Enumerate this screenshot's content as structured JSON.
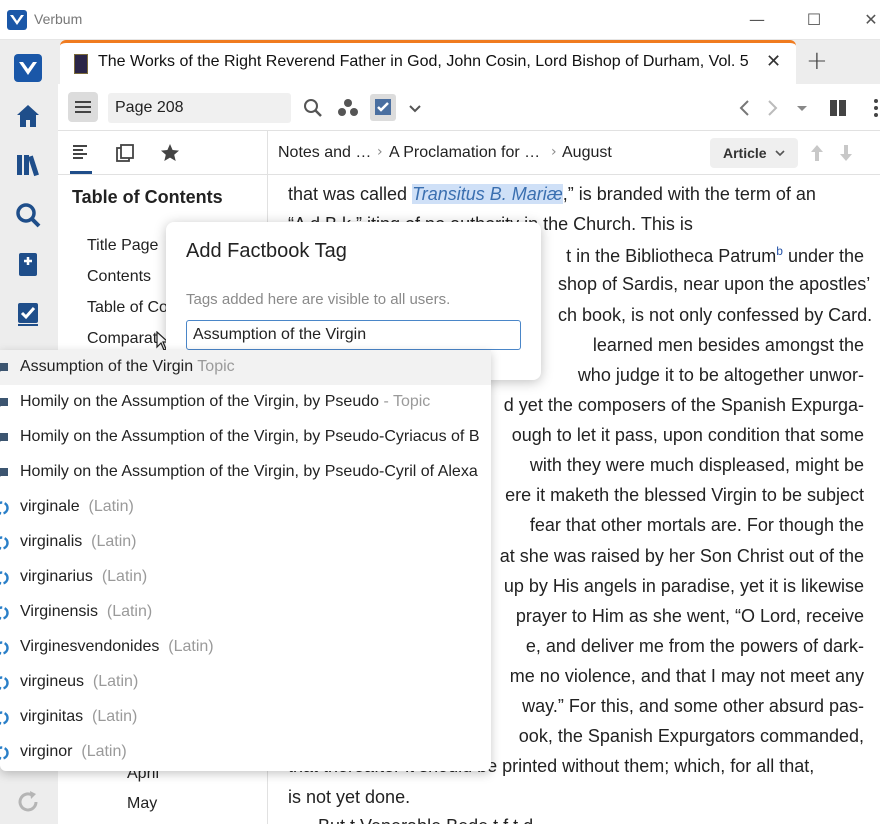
{
  "window": {
    "app_title": "Verbum",
    "minimize": "—",
    "maximize": "☐",
    "close": "✕"
  },
  "tab": {
    "title": "The Works of the Right Reverend Father in God, John Cosin, Lord Bishop of Durham, Vol. 5",
    "close": "✕",
    "new_tab": "+"
  },
  "toolbar": {
    "page_value": "Page 208"
  },
  "toc": {
    "heading": "Table of Contents",
    "items": [
      "Title Page",
      "Contents",
      "Table of Co",
      "Comparat",
      "April",
      "May"
    ]
  },
  "breadcrumb": {
    "items": [
      "Notes and …",
      "A Proclamation for …",
      "August"
    ],
    "separator": "›"
  },
  "article_button": "Article",
  "reader": {
    "line1_pre": "that  was  called ",
    "line1_hl": "Transitus B. Mariæ",
    "line1_post": ",” is branded with the term of an",
    "line2": "“A                 d B      k,”       iting of no authority in the Church. This is",
    "line3": "t in the Bibliotheca Patrum",
    "line3_sup": "b",
    "line3_post": " under the",
    "line4": "shop of Sardis, near upon the apostles’",
    "line5": "ch book, is not only confessed by Card.",
    "line6": "learned men besides amongst the",
    "line7": "who judge it to be altogether unwor-",
    "line8": "d yet the composers of the Spanish Expurga-",
    "line9": "ough to let it pass, upon condition that some",
    "line10": "with they were much displeased, might be",
    "line11": "ere it maketh the blessed Virgin to be subject",
    "line12": "fear that other mortals are. For though the",
    "line13": "at she was raised by her Son Christ out of the",
    "line14": "up by His angels in paradise, yet it is likewise",
    "line15": "prayer to Him as she went, “O Lord, receive",
    "line16": "e, and deliver me from the powers of dark-",
    "line17": "me no violence, and that I may not meet any",
    "line18": "way.” For this, and some other absurd pas-",
    "line19": "ook, the Spanish Expurgators commanded,",
    "line20": "that thereafter it should be printed without them; which, for all that,",
    "line21": "is not yet done.",
    "line22": "But        t           Venerable Bede     t        f     t  d"
  },
  "factbook": {
    "title": "Add Factbook Tag",
    "help": "Tags added here are visible to all users.",
    "input_value": "Assumption of the Virgin"
  },
  "suggestions": [
    {
      "label": "Assumption of the Virgin",
      "kind": " Topic",
      "icon": "topic-icon"
    },
    {
      "label": "Homily on the Assumption of the Virgin, by Pseudo",
      "kind": " - Topic",
      "icon": "topic-icon"
    },
    {
      "label": "Homily on the Assumption of the Virgin, by Pseudo-Cyriacus of B",
      "kind": "",
      "icon": "topic-icon"
    },
    {
      "label": "Homily on the Assumption of the Virgin, by Pseudo-Cyril of Alexa",
      "kind": "",
      "icon": "topic-icon"
    },
    {
      "label": "virginale",
      "kind": "  (Latin)",
      "icon": "lemma-icon"
    },
    {
      "label": "virginalis",
      "kind": "  (Latin)",
      "icon": "lemma-icon"
    },
    {
      "label": "virginarius",
      "kind": "  (Latin)",
      "icon": "lemma-icon"
    },
    {
      "label": "Virginensis",
      "kind": "  (Latin)",
      "icon": "lemma-icon"
    },
    {
      "label": "Virginesvendonides",
      "kind": "  (Latin)",
      "icon": "lemma-icon"
    },
    {
      "label": "virgineus",
      "kind": "  (Latin)",
      "icon": "lemma-icon"
    },
    {
      "label": "virginitas",
      "kind": "  (Latin)",
      "icon": "lemma-icon"
    },
    {
      "label": "virginor",
      "kind": "  (Latin)",
      "icon": "lemma-icon"
    }
  ],
  "colors": {
    "accent_tab": "#f07b1f",
    "app_blue": "#1a57a8",
    "highlight": "#cfe0f7",
    "focus_border": "#4a86c8"
  }
}
